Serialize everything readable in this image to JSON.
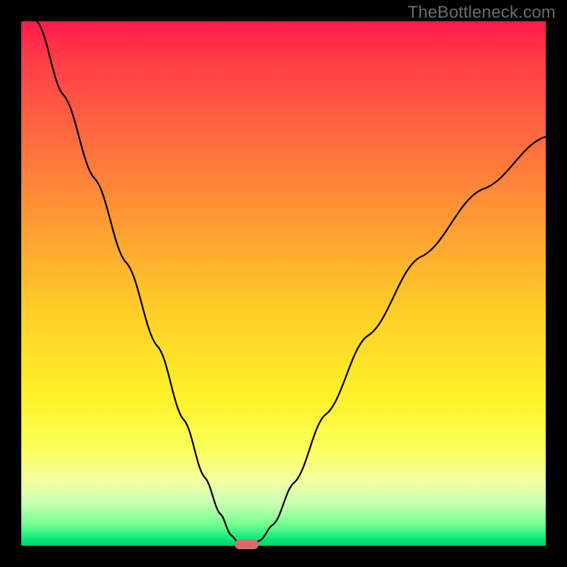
{
  "watermark": "TheBottleneck.com",
  "chart_data": {
    "type": "line",
    "title": "",
    "xlabel": "",
    "ylabel": "",
    "xlim": [
      0,
      100
    ],
    "ylim": [
      0,
      100
    ],
    "series": [
      {
        "name": "left-branch",
        "x": [
          3,
          8,
          14,
          20,
          26,
          31,
          35,
          38,
          40,
          41.5,
          42.5
        ],
        "values": [
          100,
          86,
          70,
          54,
          38,
          24,
          13,
          6,
          2,
          0.5,
          0
        ]
      },
      {
        "name": "right-branch",
        "x": [
          44,
          45.5,
          48,
          52,
          58,
          66,
          76,
          88,
          100
        ],
        "values": [
          0,
          1,
          4,
          12,
          25,
          40,
          55,
          68,
          78
        ]
      }
    ],
    "minimum_marker": {
      "x": 43,
      "y": 0
    },
    "background_gradient": {
      "top": "#ff1a4b",
      "mid": "#fff22a",
      "bottom": "#00d66a"
    }
  },
  "colors": {
    "frame": "#000000",
    "curve": "#000000",
    "marker": "#d96a6a",
    "watermark": "#6d6d6d"
  }
}
